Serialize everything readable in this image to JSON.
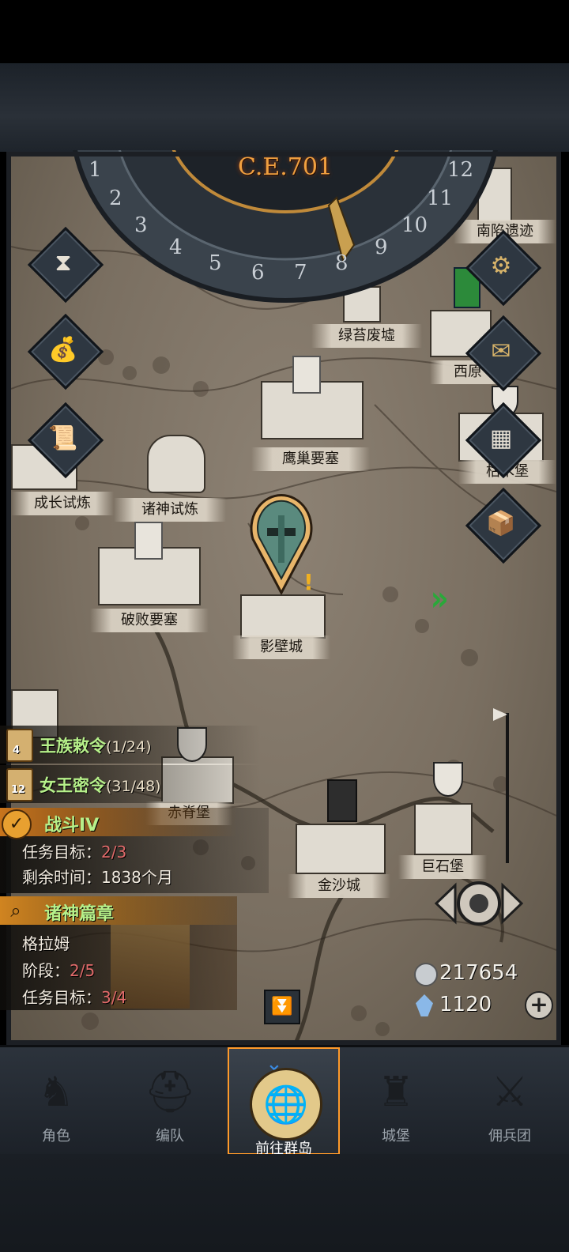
{
  "era": "C.E.701",
  "dial_numbers": [
    "1",
    "2",
    "3",
    "4",
    "5",
    "6",
    "7",
    "8",
    "9",
    "10",
    "11",
    "12"
  ],
  "locations": [
    {
      "id": "nanxian",
      "label": "南陷遗迹"
    },
    {
      "id": "lvtai",
      "label": "绿苔废墟"
    },
    {
      "id": "xiyuan",
      "label": "西原"
    },
    {
      "id": "yingchao",
      "label": "鹰巢要塞"
    },
    {
      "id": "kumu",
      "label": "枯木堡"
    },
    {
      "id": "chengzhang",
      "label": "成长试炼"
    },
    {
      "id": "zhushen",
      "label": "诸神试炼"
    },
    {
      "id": "pobai",
      "label": "破败要塞"
    },
    {
      "id": "yingbi",
      "label": "影壁城"
    },
    {
      "id": "chiji",
      "label": "赤脊堡"
    },
    {
      "id": "jinsha",
      "label": "金沙城"
    },
    {
      "id": "jushi",
      "label": "巨石堡"
    }
  ],
  "quests": {
    "royal_order": {
      "title": "王族敕令",
      "progress": "(1/24)",
      "badge": "4"
    },
    "queen_order": {
      "title": "女王密令",
      "progress": "(31/48)",
      "badge": "12"
    },
    "battle": {
      "title": "战斗IV",
      "goal_label": "任务目标：",
      "goal_value": "2/3",
      "time_label": "剩余时间：",
      "time_value": "1838个月"
    },
    "gods_chapter": {
      "title": "诸神篇章",
      "name": "格拉姆",
      "stage_label": "阶段：",
      "stage_value": "2/5",
      "goal_label": "任务目标：",
      "goal_value": "3/4"
    }
  },
  "resources": {
    "silver": "217654",
    "crystal": "1120"
  },
  "icons": {
    "hourglass": "hourglass-icon",
    "bag": "money-bag-icon",
    "scroll": "scroll-icon",
    "settings": "gear-icon",
    "mail": "mail-icon",
    "castle": "castle-gate-icon",
    "supplies": "supplies-icon"
  },
  "tabs": [
    {
      "label": "角色",
      "active": false
    },
    {
      "label": "编队",
      "active": false
    },
    {
      "label": "前往群岛",
      "active": true
    },
    {
      "label": "城堡",
      "active": false
    },
    {
      "label": "佣兵团",
      "active": false
    }
  ],
  "colors": {
    "accent": "#f0a030",
    "quest_green": "#b6f08a",
    "red_value": "#e06a6a",
    "active_tab": "#ff9a2a"
  }
}
